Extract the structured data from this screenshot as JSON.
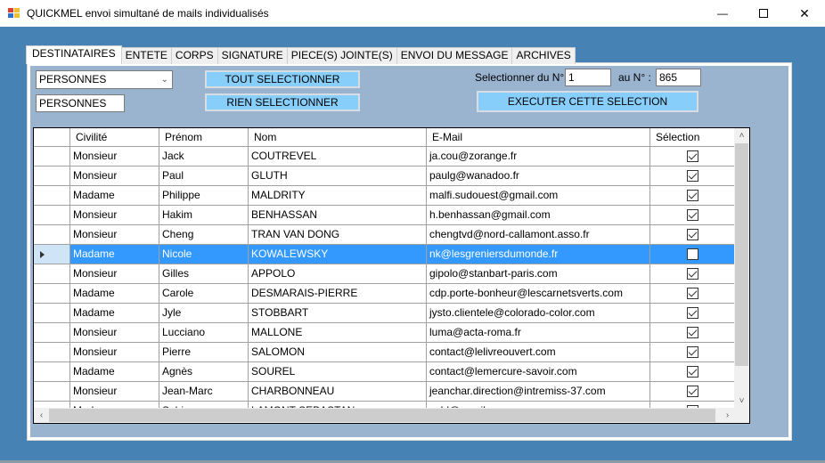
{
  "window": {
    "title": "QUICKMEL envoi simultané de mails individualisés",
    "minimize_icon": "minimize-icon",
    "maximize_icon": "maximize-icon",
    "close_icon": "close-icon",
    "minimize_glyph": "—",
    "maximize_glyph": "☐",
    "close_glyph": "✕"
  },
  "tabs": [
    {
      "label": "DESTINATAIRES",
      "active": true
    },
    {
      "label": "ENTETE",
      "active": false
    },
    {
      "label": "CORPS",
      "active": false
    },
    {
      "label": "SIGNATURE",
      "active": false
    },
    {
      "label": "PIECE(S) JOINTE(S)",
      "active": false
    },
    {
      "label": "ENVOI DU MESSAGE",
      "active": false
    },
    {
      "label": "ARCHIVES",
      "active": false
    }
  ],
  "filters": {
    "category_select": "PERSONNES",
    "category_textbox": "PERSONNES",
    "select_all_label": "TOUT SELECTIONNER",
    "select_none_label": "RIEN SELECTIONNER",
    "range_from_label": "Selectionner du N° :",
    "range_from_value": "1",
    "range_to_label": "au N° :",
    "range_to_value": "865",
    "execute_label": "EXECUTER CETTE SELECTION"
  },
  "grid": {
    "columns": [
      "Civilité",
      "Prénom",
      "Nom",
      "E-Mail",
      "Sélection"
    ],
    "rows": [
      {
        "civilite": "Monsieur",
        "prenom": "Jack",
        "nom": "COUTREVEL",
        "email": "ja.cou@zorange.fr",
        "selected": true
      },
      {
        "civilite": "Monsieur",
        "prenom": "Paul",
        "nom": "GLUTH",
        "email": "paulg@wanadoo.fr",
        "selected": true
      },
      {
        "civilite": "Madame",
        "prenom": "Philippe",
        "nom": "MALDRITY",
        "email": "malfi.sudouest@gmail.com",
        "selected": true
      },
      {
        "civilite": "Monsieur",
        "prenom": "Hakim",
        "nom": "BENHASSAN",
        "email": "h.benhassan@gmail.com",
        "selected": true
      },
      {
        "civilite": "Monsieur",
        "prenom": "Cheng",
        "nom": "TRAN VAN DONG",
        "email": "chengtvd@nord-callamont.asso.fr",
        "selected": true
      },
      {
        "civilite": "Madame",
        "prenom": "Nicole",
        "nom": "KOWALEWSKY",
        "email": "nk@lesgreniersdumonde.fr",
        "selected": false,
        "current": true
      },
      {
        "civilite": "Monsieur",
        "prenom": "Gilles",
        "nom": "APPOLO",
        "email": "gipolo@stanbart-paris.com",
        "selected": true
      },
      {
        "civilite": "Madame",
        "prenom": "Carole",
        "nom": "DESMARAIS-PIERRE",
        "email": "cdp.porte-bonheur@lescarnetsverts.com",
        "selected": true
      },
      {
        "civilite": "Madame",
        "prenom": "Jyle",
        "nom": "STOBBART",
        "email": "jysto.clientele@colorado-color.com",
        "selected": true
      },
      {
        "civilite": "Monsieur",
        "prenom": "Lucciano",
        "nom": "MALLONE",
        "email": "luma@acta-roma.fr",
        "selected": true
      },
      {
        "civilite": "Monsieur",
        "prenom": "Pierre",
        "nom": "SALOMON",
        "email": "contact@lelivreouvert.com",
        "selected": true
      },
      {
        "civilite": "Madame",
        "prenom": "Agnès",
        "nom": "SOUREL",
        "email": "contact@lemercure-savoir.com",
        "selected": true
      },
      {
        "civilite": "Monsieur",
        "prenom": "Jean-Marc",
        "nom": "CHARBONNEAU",
        "email": "jeanchar.direction@intremiss-37.com",
        "selected": true
      },
      {
        "civilite": "Madame",
        "prenom": "Sabine",
        "nom": "LAMONT SEBASTAN",
        "email": "sabl@gmail.com",
        "selected": true
      }
    ],
    "scroll_up_glyph": "˄",
    "scroll_down_glyph": "˅",
    "scroll_left_glyph": "‹",
    "scroll_right_glyph": "›"
  },
  "colors": {
    "client_bg": "#4682b4",
    "panel_bg": "#9ab4d0",
    "button_bg": "#87cefa",
    "selection_bg": "#3399ff"
  }
}
